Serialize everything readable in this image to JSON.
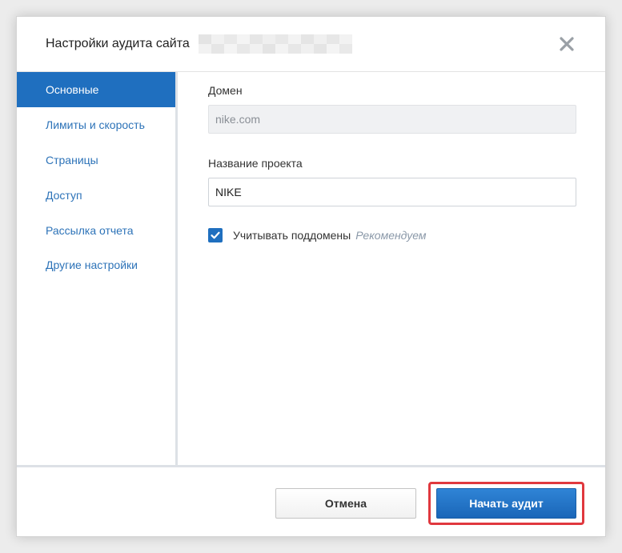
{
  "dialog": {
    "title": "Настройки аудита сайта",
    "close_icon": "close-icon"
  },
  "sidebar": {
    "items": [
      {
        "label": "Основные",
        "active": true
      },
      {
        "label": "Лимиты и скорость",
        "active": false
      },
      {
        "label": "Страницы",
        "active": false
      },
      {
        "label": "Доступ",
        "active": false
      },
      {
        "label": "Рассылка отчета",
        "active": false
      },
      {
        "label": "Другие настройки",
        "active": false
      }
    ]
  },
  "form": {
    "domain_label": "Домен",
    "domain_value": "nike.com",
    "project_label": "Название проекта",
    "project_value": "NIKE",
    "subdomains_checked": true,
    "subdomains_label": "Учитывать поддомены",
    "subdomains_hint": "Рекомендуем"
  },
  "footer": {
    "cancel_label": "Отмена",
    "start_label": "Начать аудит"
  },
  "colors": {
    "accent": "#1f6fbf",
    "link": "#2d73b8",
    "highlight": "#e0383e"
  }
}
